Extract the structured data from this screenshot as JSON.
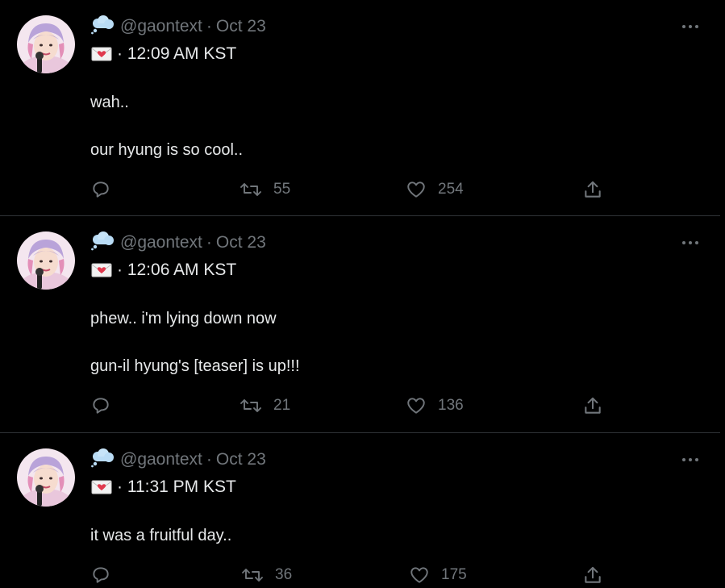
{
  "colors": {
    "background": "#000000",
    "text": "#e7e9ea",
    "muted": "#71767b",
    "divider": "#2f3336"
  },
  "tweets": [
    {
      "handle": "@gaontext",
      "separator": "·",
      "date": "Oct 23",
      "time": "· 12:09 AM KST",
      "lines": [
        "wah..",
        "our hyung is so cool.."
      ],
      "retweets": "55",
      "likes": "254",
      "icons": [
        "thought-cloud-icon",
        "love-letter-icon"
      ]
    },
    {
      "handle": "@gaontext",
      "separator": "·",
      "date": "Oct 23",
      "time": "· 12:06 AM KST",
      "lines": [
        "phew.. i'm lying down now",
        "gun-il hyung's [teaser] is up!!!"
      ],
      "retweets": "21",
      "likes": "136",
      "icons": [
        "thought-cloud-icon",
        "love-letter-icon"
      ]
    },
    {
      "handle": "@gaontext",
      "separator": "·",
      "date": "Oct 23",
      "time": "· 11:31 PM KST",
      "lines": [
        "it was a fruitful day.."
      ],
      "retweets": "36",
      "likes": "175",
      "icons": [
        "thought-cloud-icon",
        "love-letter-icon"
      ]
    }
  ]
}
